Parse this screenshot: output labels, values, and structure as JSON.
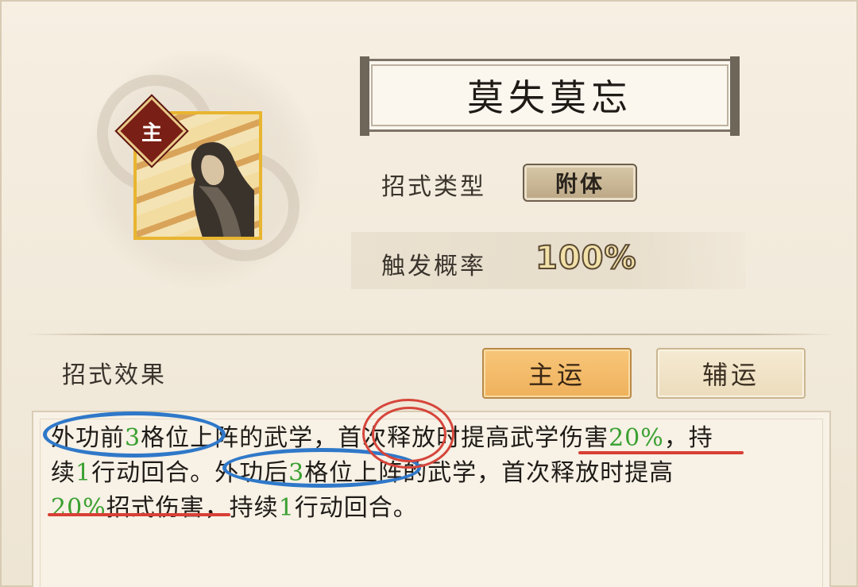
{
  "skill": {
    "name": "莫失莫忘",
    "role_badge": "主",
    "type_label": "招式类型",
    "type_value": "附体",
    "rate_label": "触发概率",
    "rate_value": "100%"
  },
  "effect": {
    "label": "招式效果",
    "tabs": [
      {
        "label": "主运",
        "selected": true
      },
      {
        "label": "辅运",
        "selected": false
      }
    ],
    "line1": {
      "a": "外功前",
      "n1": "3",
      "b": "格位上阵的武学，首次释放时提高武学伤害",
      "n2": "20%",
      "c": "，持"
    },
    "line2": {
      "a": "续",
      "n1": "1",
      "b": "行动回合。外功后",
      "n2": "3",
      "c": "格位上阵的武学，首次释放时提高"
    },
    "line3": {
      "n1": "20%",
      "a": "招式伤害，持续",
      "n2": "1",
      "b": "行动回合。"
    }
  },
  "colors": {
    "highlight_number": "#3aa030",
    "annotation_blue": "#2f78c9",
    "annotation_red": "#d6453b",
    "selected_tab": "#f0b35e"
  }
}
